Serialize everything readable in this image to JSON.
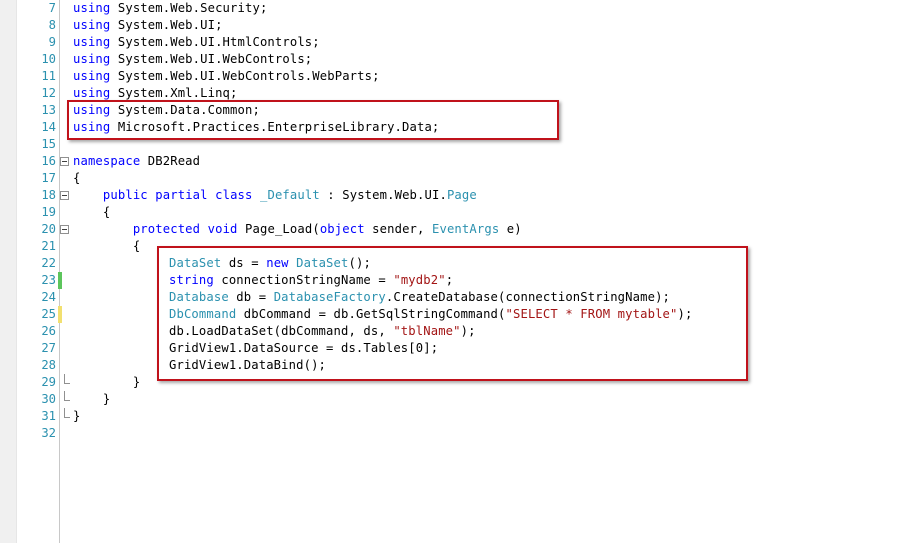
{
  "line_numbers": [
    "7",
    "8",
    "9",
    "10",
    "11",
    "12",
    "13",
    "14",
    "15",
    "16",
    "17",
    "18",
    "19",
    "20",
    "21",
    "22",
    "23",
    "24",
    "25",
    "26",
    "27",
    "28",
    "29",
    "30",
    "31",
    "32"
  ],
  "using_keyword": "using",
  "namespaces": [
    "System.Web.Security;",
    "System.Web.UI;",
    "System.Web.UI.HtmlControls;",
    "System.Web.UI.WebControls;",
    "System.Web.UI.WebControls.WebParts;",
    "System.Xml.Linq;",
    "System.Data.Common;",
    "Microsoft.Practices.EnterpriseLibrary.Data;"
  ],
  "namespace_decl": {
    "keyword": "namespace",
    "name": "DB2Read"
  },
  "class_decl": {
    "public": "public",
    "partial": "partial",
    "class": "class",
    "name": "_Default",
    "colon": " : System.Web.UI.",
    "base": "Page"
  },
  "method_decl": {
    "protected": "protected",
    "void": "void",
    "name": "Page_Load(",
    "object": "object",
    "sender": " sender, ",
    "eventargs": "EventArgs",
    "end": " e)"
  },
  "braces": {
    "open": "{",
    "close": "}"
  },
  "body": {
    "l22": {
      "t1": "DataSet",
      "a": " ds = ",
      "kw": "new",
      "b": " ",
      "t2": "DataSet",
      "c": "();"
    },
    "l23": {
      "kw": "string",
      "a": " connectionStringName = ",
      "s": "\"mydb2\"",
      "c": ";"
    },
    "l24": {
      "t1": "Database",
      "a": " db = ",
      "t2": "DatabaseFactory",
      "c": ".CreateDatabase(connectionStringName);"
    },
    "l25": {
      "t1": "DbCommand",
      "a": " dbCommand = db.GetSqlStringCommand(",
      "s": "\"SELECT * FROM mytable\"",
      "c": ");"
    },
    "l26": {
      "a": "db.LoadDataSet(dbCommand, ds, ",
      "s": "\"tblName\"",
      "c": ");"
    },
    "l27": {
      "a": "GridView1.DataSource = ds.Tables[0];"
    },
    "l28": {
      "a": "GridView1.DataBind();"
    }
  },
  "colors": {
    "keyword": "#0000ff",
    "type": "#2b91af",
    "string": "#a31515",
    "line_number": "#2b91af",
    "highlight_box": "#c0121b",
    "changed_saved": "#5cc55c",
    "changed_unsaved": "#f2e070"
  }
}
